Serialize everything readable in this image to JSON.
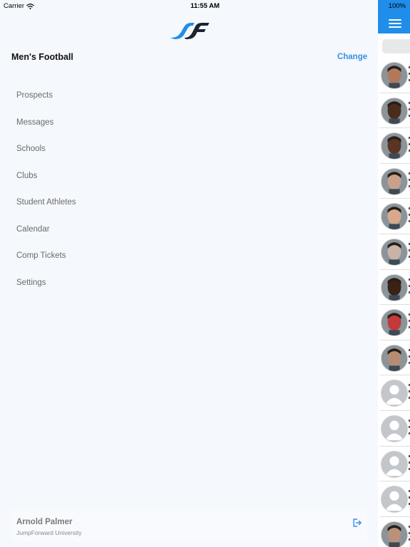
{
  "status_bar": {
    "carrier": "Carrier",
    "time": "11:55 AM",
    "battery": "100%"
  },
  "header": {
    "team": "Men's Football",
    "change_label": "Change"
  },
  "nav": {
    "items": [
      {
        "label": "Prospects"
      },
      {
        "label": "Messages"
      },
      {
        "label": "Schools"
      },
      {
        "label": "Clubs"
      },
      {
        "label": "Student Athletes"
      },
      {
        "label": "Calendar"
      },
      {
        "label": "Comp Tickets"
      },
      {
        "label": "Settings"
      }
    ]
  },
  "user": {
    "name": "Arnold Palmer",
    "org": "JumpForward University"
  },
  "colors": {
    "accent": "#1f8dea",
    "link": "#3a8ee6",
    "drawer_bg": "#f5f8fc"
  },
  "icons": {
    "menu": "hamburger-menu-icon",
    "logout": "logout-icon",
    "wifi": "wifi-icon",
    "battery": "battery-icon"
  },
  "athletes": [
    {
      "avatar": "photo",
      "skin": "#b07a5a"
    },
    {
      "avatar": "photo",
      "skin": "#4a2c1d"
    },
    {
      "avatar": "photo",
      "skin": "#5a3424"
    },
    {
      "avatar": "photo",
      "skin": "#c9a08a"
    },
    {
      "avatar": "photo",
      "skin": "#d8a98d"
    },
    {
      "avatar": "photo",
      "skin": "#c9b2a6"
    },
    {
      "avatar": "photo",
      "skin": "#3b2216"
    },
    {
      "avatar": "photo",
      "skin": "#c43a3a"
    },
    {
      "avatar": "photo",
      "skin": "#b58c74"
    },
    {
      "avatar": "placeholder"
    },
    {
      "avatar": "placeholder"
    },
    {
      "avatar": "placeholder"
    },
    {
      "avatar": "placeholder"
    },
    {
      "avatar": "photo",
      "skin": "#b9907a"
    }
  ]
}
